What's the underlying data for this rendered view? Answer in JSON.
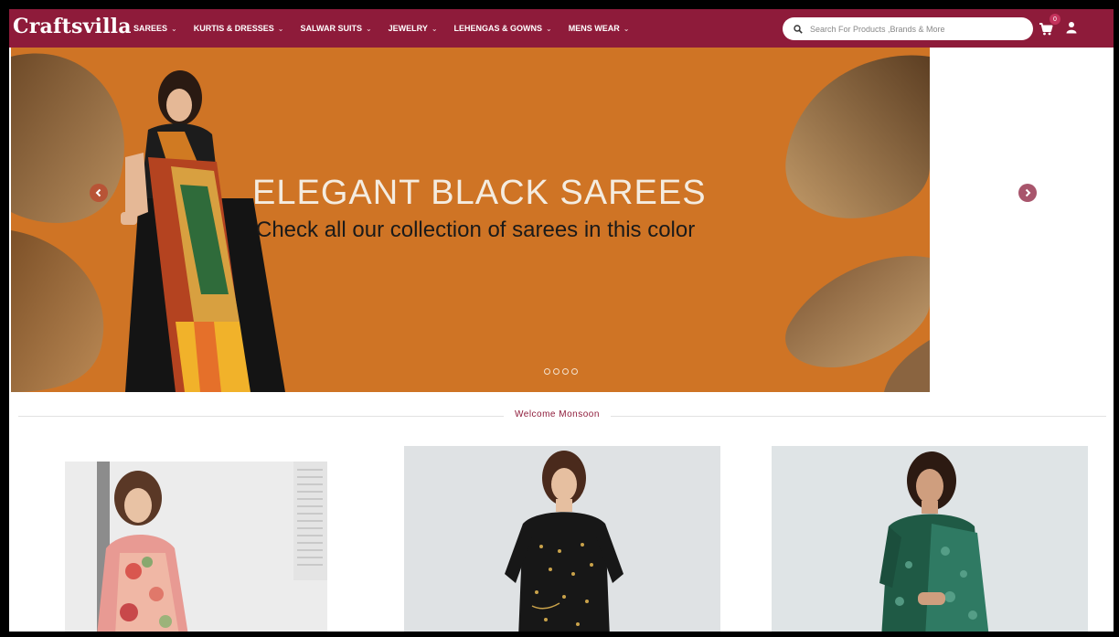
{
  "brand": {
    "logo_text": "Craftsvilla",
    "primary_color": "#8e1b3a"
  },
  "nav": {
    "items": [
      {
        "label": "SAREES"
      },
      {
        "label": "KURTIS & DRESSES"
      },
      {
        "label": "SALWAR SUITS"
      },
      {
        "label": "JEWELRY"
      },
      {
        "label": "LEHENGAS & GOWNS"
      },
      {
        "label": "MENS WEAR"
      }
    ],
    "chevron": "⌄"
  },
  "search": {
    "placeholder": "Search For Products ,Brands & More",
    "icon": "search-icon"
  },
  "cart": {
    "count": "0",
    "icon": "cart-icon"
  },
  "user": {
    "icon": "user-icon"
  },
  "hero": {
    "title": "ELEGANT BLACK SAREES",
    "subtitle": "Check all our collection of sarees in this color",
    "background_color": "#cf7425",
    "slide_count": 4,
    "prev_icon": "chevron-left-circle-icon",
    "next_icon": "chevron-right-circle-icon"
  },
  "section": {
    "title": "Welcome Monsoon"
  },
  "products": [
    {
      "name": "floral-saree-product"
    },
    {
      "name": "black-kurti-product"
    },
    {
      "name": "green-saree-product"
    }
  ]
}
